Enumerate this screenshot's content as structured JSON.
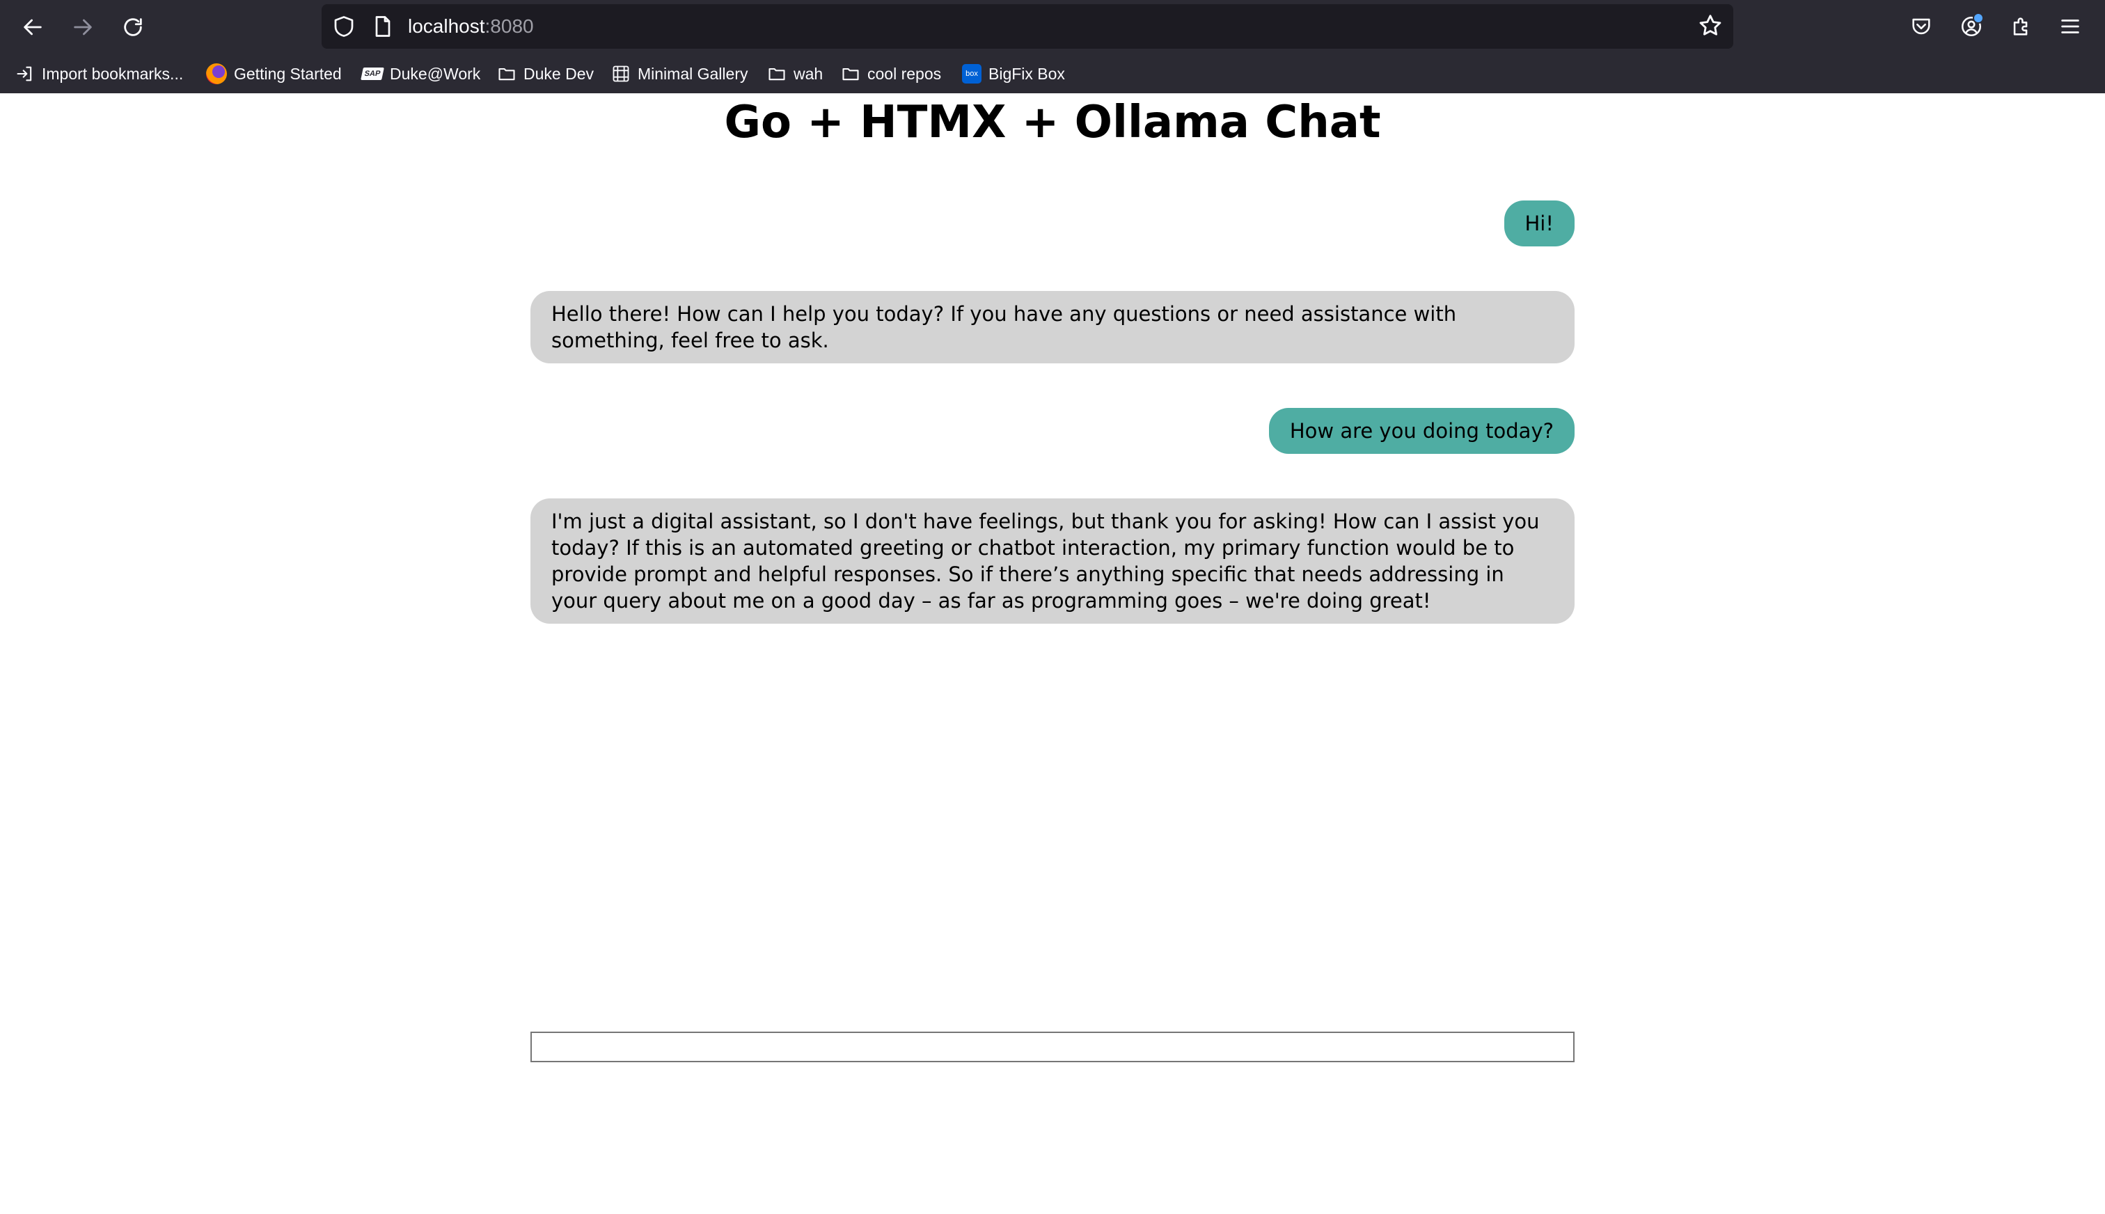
{
  "browser": {
    "url_host": "localhost",
    "url_port": ":8080",
    "bookmarks": [
      {
        "label": "Import bookmarks...",
        "icon": "import-icon"
      },
      {
        "label": "Getting Started",
        "icon": "firefox-icon"
      },
      {
        "label": "Duke@Work",
        "icon": "sap-icon"
      },
      {
        "label": "Duke Dev",
        "icon": "folder-icon"
      },
      {
        "label": "Minimal Gallery",
        "icon": "gallery-icon"
      },
      {
        "label": "wah",
        "icon": "folder-icon"
      },
      {
        "label": "cool repos",
        "icon": "folder-icon"
      },
      {
        "label": "BigFix Box",
        "icon": "box-icon"
      }
    ],
    "sap_logo_text": "SAP",
    "box_logo_text": "box"
  },
  "page": {
    "title": "Go + HTMX + Ollama Chat"
  },
  "messages": [
    {
      "role": "user",
      "text": "Hi!"
    },
    {
      "role": "assistant",
      "text": "Hello there! How can I help you today? If you have any questions or need assistance with something, feel free to ask."
    },
    {
      "role": "user",
      "text": "How are you doing today?"
    },
    {
      "role": "assistant",
      "text": "I'm just a digital assistant, so I don't have feelings, but thank you for asking! How can I assist you today? If this is an automated greeting or chatbot interaction, my primary function would be to provide prompt and helpful responses. So if there’s anything specific that needs addressing in your query about me on a good day – as far as programming goes – we're doing great!"
    }
  ],
  "chat_input": {
    "value": "",
    "placeholder": ""
  },
  "colors": {
    "user_bubble": "#4fada3",
    "assistant_bubble": "#d3d3d3",
    "chrome": "#2b2a33"
  }
}
